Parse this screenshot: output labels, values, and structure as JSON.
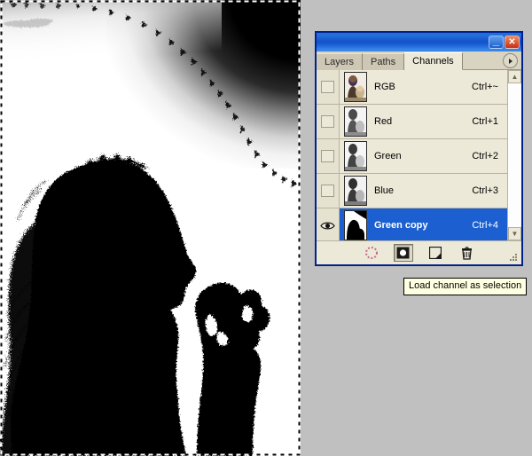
{
  "document": {
    "name": "photoshop-canvas",
    "description": "Black and white high-contrast channel mask: silhouette of a woman with long hair holding an object near her face, white background, dark gradient in upper right corner, marching-ants selection around the whole canvas"
  },
  "palette": {
    "titlebar": {
      "minimize_label": "_",
      "close_label": "✕"
    },
    "tabs": [
      {
        "label": "Layers",
        "active": false
      },
      {
        "label": "Paths",
        "active": false
      },
      {
        "label": "Channels",
        "active": true
      }
    ],
    "menu_button": "palette-menu",
    "channels": [
      {
        "name": "RGB",
        "shortcut": "Ctrl+~",
        "visible": false,
        "selected": false,
        "thumb": "color"
      },
      {
        "name": "Red",
        "shortcut": "Ctrl+1",
        "visible": false,
        "selected": false,
        "thumb": "gray"
      },
      {
        "name": "Green",
        "shortcut": "Ctrl+2",
        "visible": false,
        "selected": false,
        "thumb": "gray"
      },
      {
        "name": "Blue",
        "shortcut": "Ctrl+3",
        "visible": false,
        "selected": false,
        "thumb": "gray"
      },
      {
        "name": "Green copy",
        "shortcut": "Ctrl+4",
        "visible": true,
        "selected": true,
        "thumb": "mask"
      }
    ],
    "toolbar": [
      {
        "icon": "load-channel-as-selection-icon",
        "pressed": false
      },
      {
        "icon": "save-selection-as-channel-icon",
        "pressed": true
      },
      {
        "icon": "new-channel-icon",
        "pressed": false
      },
      {
        "icon": "delete-channel-icon",
        "pressed": false
      }
    ],
    "scrollbar": {
      "up": "▲",
      "down": "▼"
    }
  },
  "tooltip": {
    "text": "Load channel as selection"
  },
  "colors": {
    "titlebar_blue": "#1352c9",
    "selection_blue": "#1b5fd0",
    "panel_bg": "#ece9d8",
    "panel_border": "#00228e",
    "desktop_gray": "#c0c0c0",
    "tooltip_bg": "#ffffe1"
  }
}
